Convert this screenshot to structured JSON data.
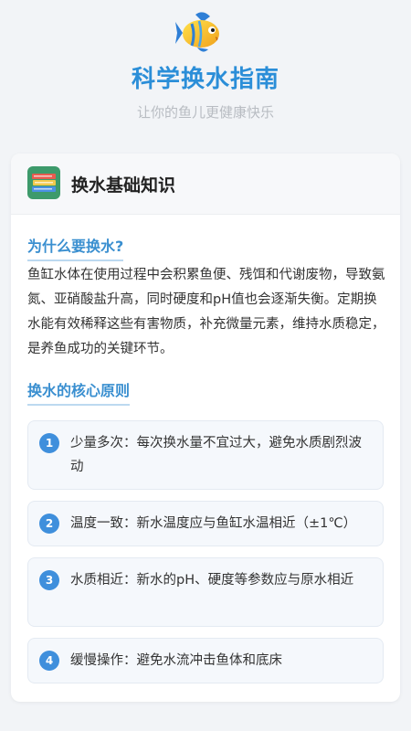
{
  "header": {
    "title": "科学换水指南",
    "subtitle": "让你的鱼儿更健康快乐",
    "logo_icon": "fish-icon"
  },
  "card": {
    "icon": "books-icon",
    "title": "换水基础知识",
    "why_title": "为什么要换水?",
    "why_text": "鱼缸水体在使用过程中会积累鱼便、残饵和代谢废物，导致氨氮、亚硝酸盐升高，同时硬度和pH值也会逐渐失衡。定期换水能有效稀释这些有害物质，补充微量元素，维持水质稳定，是养鱼成功的关键环节。",
    "principles_title": "换水的核心原则",
    "principles": [
      {
        "num": "1",
        "text": "少量多次：每次换水量不宜过大，避免水质剧烈波动"
      },
      {
        "num": "2",
        "text": "温度一致：新水温度应与鱼缸水温相近（±1℃）"
      },
      {
        "num": "3",
        "text": "水质相近：新水的pH、硬度等参数应与原水相近"
      },
      {
        "num": "4",
        "text": "缓慢操作：避免水流冲击鱼体和底床"
      }
    ]
  },
  "colors": {
    "accent": "#2b8ed8",
    "badge": "#3f8fdc",
    "background": "#f2f4f7"
  }
}
